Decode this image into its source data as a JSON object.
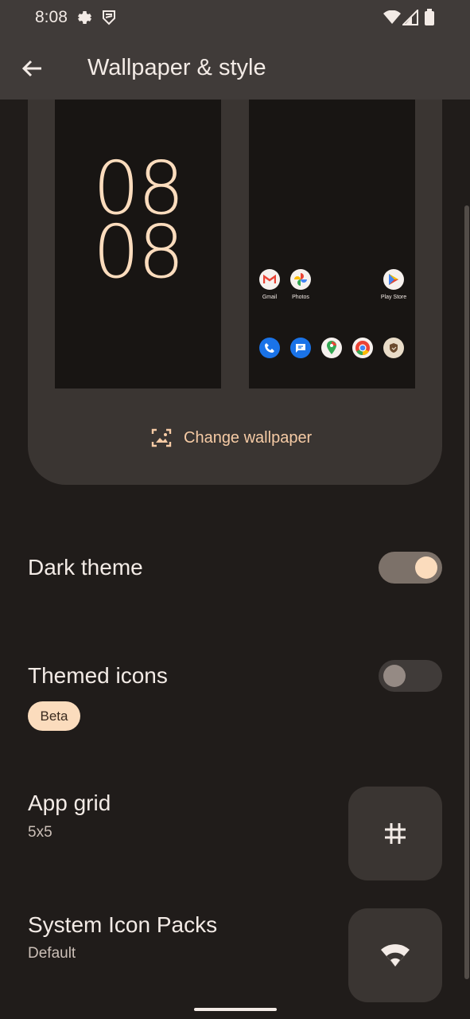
{
  "status_bar": {
    "time": "8:08"
  },
  "app_bar": {
    "title": "Wallpaper & style"
  },
  "preview": {
    "clock_line1": "08",
    "clock_line2": "08",
    "apps_row1": [
      {
        "label": "Gmail",
        "icon": "gmail-icon"
      },
      {
        "label": "Photos",
        "icon": "photos-icon"
      },
      {
        "label": "Play Store",
        "icon": "play-store-icon"
      }
    ],
    "dock": [
      "phone-icon",
      "messages-icon",
      "maps-icon",
      "chrome-icon",
      "security-icon"
    ],
    "change_wallpaper_label": "Change wallpaper"
  },
  "settings": {
    "dark_theme": {
      "label": "Dark theme",
      "enabled": true
    },
    "themed_icons": {
      "label": "Themed icons",
      "badge": "Beta",
      "enabled": false
    },
    "app_grid": {
      "label": "App grid",
      "value": "5x5"
    },
    "icon_packs": {
      "label": "System Icon Packs",
      "value": "Default"
    }
  },
  "colors": {
    "background": "#201c1a",
    "surface": "#3a3532",
    "accent": "#fbdcbd",
    "accent_text": "#f6cba5"
  }
}
